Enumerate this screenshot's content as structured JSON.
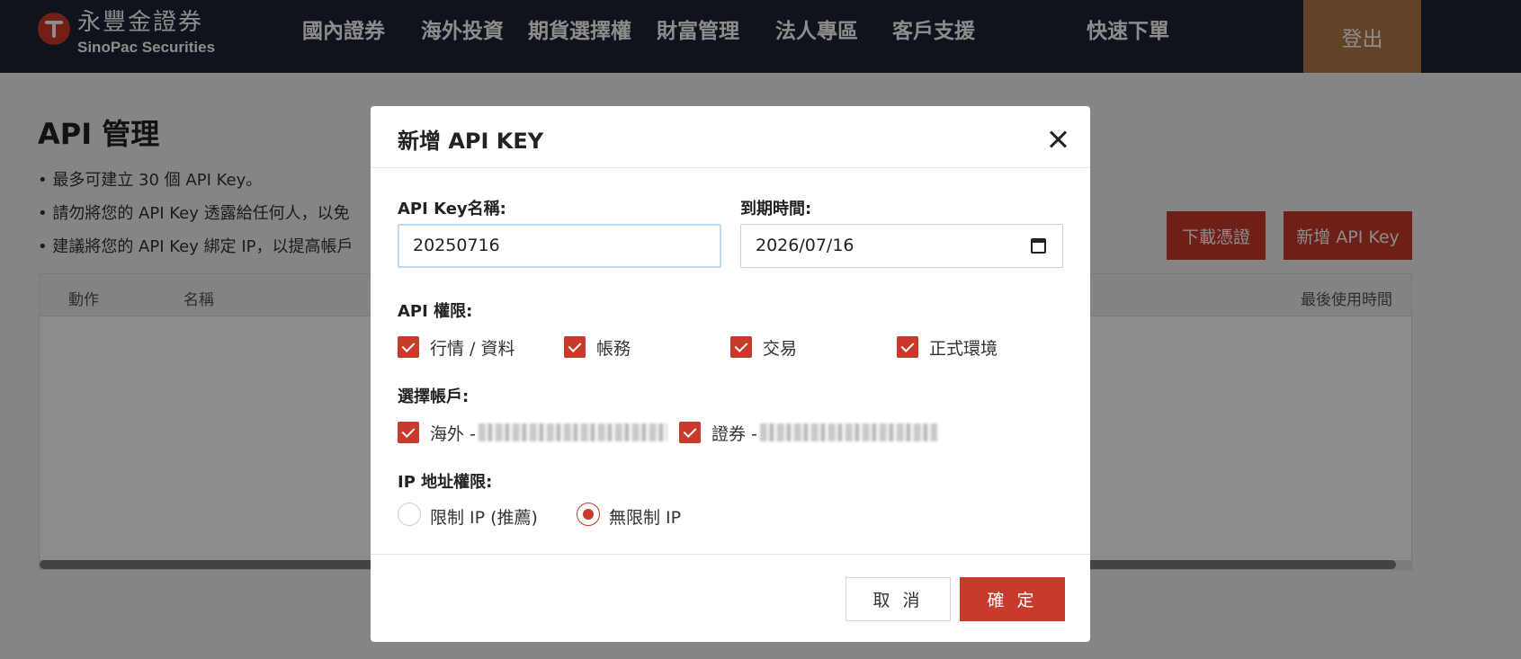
{
  "header": {
    "logo_cn": "永豐金證券",
    "logo_en": "SinoPac Securities",
    "nav": [
      "國內證券",
      "海外投資",
      "期貨選擇權",
      "財富管理",
      "法人專區",
      "客戶支援",
      "快速下單"
    ],
    "logout_label": "登出"
  },
  "page": {
    "title": "API 管理",
    "notes": [
      "• 最多可建立 30 個 API Key。",
      "• 請勿將您的 API Key 透露給任何人，以免",
      "• 建議將您的 API Key 綁定 IP，以提高帳戶"
    ],
    "download_cert_label": "下載憑證",
    "add_key_label": "新增 API Key",
    "table_headers": {
      "action": "動作",
      "name": "名稱",
      "last_used": "最後使用時間"
    }
  },
  "modal": {
    "title": "新增 API KEY",
    "name_label": "API Key名稱:",
    "name_value": "20250716",
    "expiry_label": "到期時間:",
    "expiry_value": "2026/07/16",
    "permissions_label": "API 權限:",
    "permissions": [
      {
        "label": "行情 / 資料",
        "checked": true
      },
      {
        "label": "帳務",
        "checked": true
      },
      {
        "label": "交易",
        "checked": true
      },
      {
        "label": "正式環境",
        "checked": true
      }
    ],
    "accounts_label": "選擇帳戶:",
    "accounts": [
      {
        "label": "海外 -",
        "checked": true
      },
      {
        "label": "證券 -",
        "checked": true
      }
    ],
    "ip_label": "IP 地址權限:",
    "ip_options": [
      {
        "label": "限制 IP (推薦)",
        "selected": false
      },
      {
        "label": "無限制 IP",
        "selected": true
      }
    ],
    "cancel_label": "取 消",
    "confirm_label": "確 定"
  },
  "colors": {
    "nav_bg": "#1c2434",
    "logout_bg": "#b57b48",
    "brand_red": "#c83a2b",
    "focus_border": "#bfd9ef"
  }
}
